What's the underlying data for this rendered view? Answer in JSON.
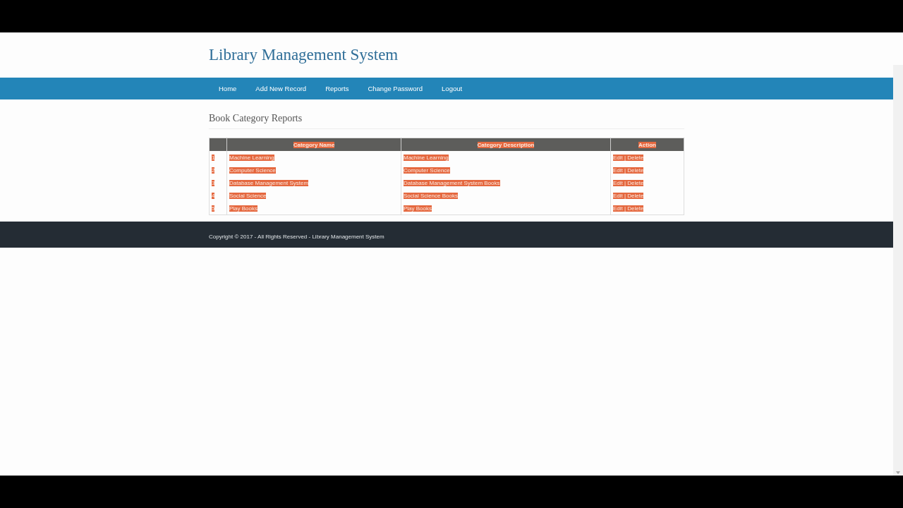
{
  "header": {
    "title": "Library Management System"
  },
  "nav": [
    {
      "label": "Home"
    },
    {
      "label": "Add New Record"
    },
    {
      "label": "Reports"
    },
    {
      "label": "Change Password"
    },
    {
      "label": "Logout"
    }
  ],
  "page_heading": "Book Category Reports",
  "table": {
    "text_selected": true,
    "columns": [
      "",
      "Category Name",
      "Category Description",
      "Action"
    ],
    "rows": [
      {
        "number": "1",
        "name": "Machine Learning",
        "description": "Machine Learning",
        "actions": [
          "Edit",
          "Delete"
        ],
        "separator": "|"
      },
      {
        "number": "2",
        "name": "Computer Science",
        "description": "Computer Science",
        "actions": [
          "Edit",
          "Delete"
        ],
        "separator": "|"
      },
      {
        "number": "3",
        "name": "Database Management System",
        "description": "Database Management System Books",
        "actions": [
          "Edit",
          "Delete"
        ],
        "separator": "|"
      },
      {
        "number": "4",
        "name": "Social Science",
        "description": "Social Science Books",
        "actions": [
          "Edit",
          "Delete"
        ],
        "separator": "|"
      },
      {
        "number": "5",
        "name": "Play Books",
        "description": "Play Books",
        "actions": [
          "Edit",
          "Delete"
        ],
        "separator": "|"
      }
    ]
  },
  "footer": {
    "text": "Copyright © 2017 - All Rights Reserved - Library Management System"
  }
}
